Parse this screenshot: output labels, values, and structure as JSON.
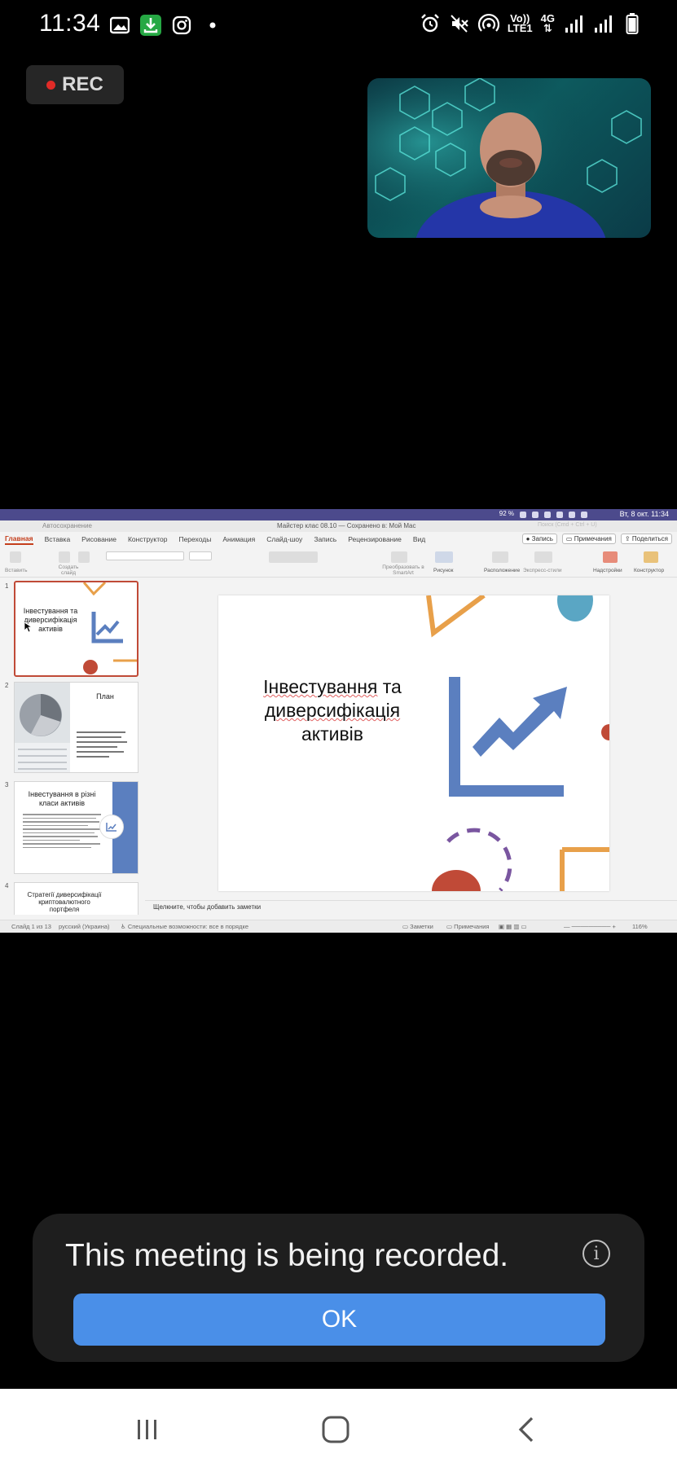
{
  "status_bar": {
    "time": "11:34",
    "network_top": "Vo))",
    "network_bottom": "LTE1",
    "network_gen": "4G"
  },
  "recording_badge": {
    "label": "REC"
  },
  "shared_screen": {
    "mac_menubar": {
      "battery": "92 %",
      "clock": "Вт, 8 окт.  11:34"
    },
    "title_bar": {
      "autosave": "Автосохранение",
      "document_title": "Майстер клас 08.10 — Сохранено в: Мой Mac",
      "search_placeholder": "Поиск (Cmd + Ctrl + U)"
    },
    "ribbon_tabs": [
      "Главная",
      "Вставка",
      "Рисование",
      "Конструктор",
      "Переходы",
      "Анимация",
      "Слайд-шоу",
      "Запись",
      "Рецензирование",
      "Вид"
    ],
    "ribbon_buttons": {
      "record": "Запись",
      "comments": "Примечания",
      "share": "Поделиться"
    },
    "ribbon_labels": {
      "paste": "Вставить",
      "new_slide": "Создать слайд",
      "smartart": "Преобразовать в SmartArt",
      "picture": "Рисунок",
      "arrange": "Расположение",
      "quick_styles": "Экспресс-стили",
      "addins": "Надстройки",
      "designer": "Конструктор"
    },
    "thumbnails": [
      {
        "number": "1",
        "title": "Інвестування та диверсифікація активів"
      },
      {
        "number": "2",
        "title": "План"
      },
      {
        "number": "3",
        "title": "Інвестування в різні класи активів"
      },
      {
        "number": "4",
        "title": "Стратегії диверсифікації криптовалютного портфеля"
      }
    ],
    "slide": {
      "title_line1_a": "Інвестування",
      "title_line1_b": " та",
      "title_line2": "диверсифікація",
      "title_line3": "активів"
    },
    "notes_placeholder": "Щелкните, чтобы добавить заметки",
    "status_line": {
      "slide_count": "Слайд 1 из 13",
      "language": "русский (Украина)",
      "accessibility": "Специальные возможности: все в порядке",
      "notes": "Заметки",
      "comments": "Примечания",
      "zoom": "116%"
    },
    "colors": {
      "accent_orange": "#e8a04a",
      "accent_blue": "#5b7fbf",
      "accent_red": "#c04a37",
      "accent_teal": "#5aa6c4"
    }
  },
  "dialog": {
    "message": "This meeting is being recorded.",
    "ok_label": "OK"
  },
  "navbar": {
    "icons": [
      "recent-apps-icon",
      "home-icon",
      "back-icon"
    ]
  }
}
